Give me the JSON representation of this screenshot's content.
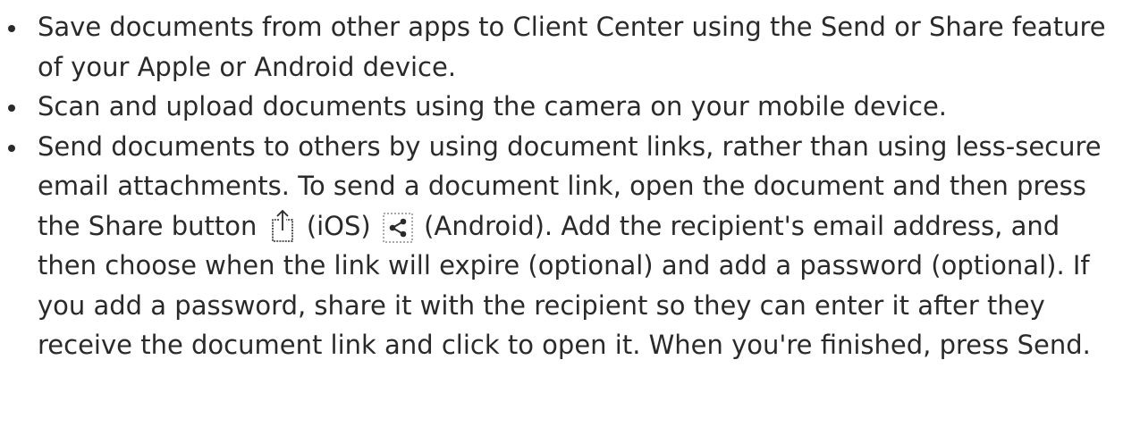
{
  "items": [
    {
      "text": "Save documents from other apps to Client Center using the Send or Share feature of your Apple or Android device."
    },
    {
      "text": "Scan and upload documents using the camera on your mobile device."
    },
    {
      "text_part1": "Send documents to others by using document links, rather than using less-secure email attachments. To send a document link, open the document and then press the Share button",
      "ios_label": "(iOS)",
      "android_label": "(Android).",
      "text_part2": "Add the recipient's email address, and then choose when the link will expire (optional) and add a password (optional). If you add a password, share it with the recipient so they can enter it after they receive the document link and click to open it. When you're finished, press Send."
    }
  ],
  "icons": {
    "ios_share": "share-ios-icon",
    "android_share": "share-android-icon"
  },
  "colors": {
    "text": "#2a2a2a",
    "background": "#ffffff"
  }
}
